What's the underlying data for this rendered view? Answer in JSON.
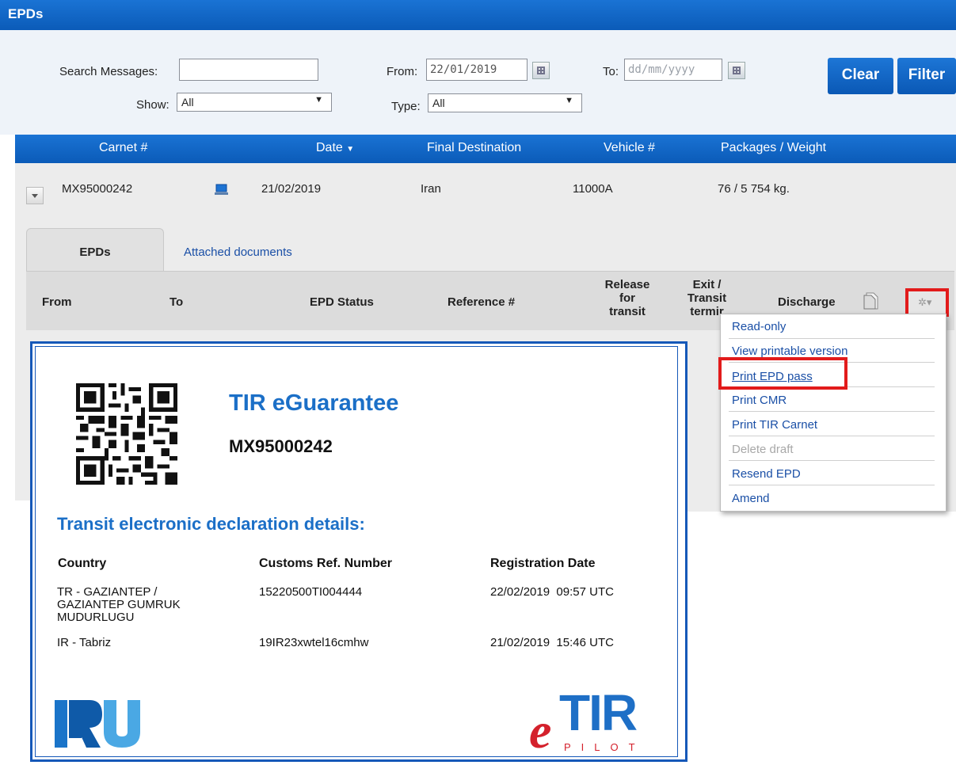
{
  "window": {
    "title": "EPDs"
  },
  "filters": {
    "search_label": "Search Messages:",
    "search_value": "",
    "from_label": "From:",
    "from_value": "22/01/2019",
    "to_label": "To:",
    "to_placeholder": "dd/mm/yyyy",
    "show_label": "Show:",
    "show_value": "All",
    "type_label": "Type:",
    "type_value": "All",
    "clear_label": "Clear",
    "filter_label": "Filter"
  },
  "table": {
    "headers": {
      "carnet": "Carnet #",
      "date": "Date",
      "destination": "Final Destination",
      "vehicle": "Vehicle #",
      "packages": "Packages / Weight"
    },
    "row": {
      "carnet": "MX95000242",
      "date": "21/02/2019",
      "destination": "Iran",
      "vehicle": "11000A",
      "packages": "76 / 5 754 kg."
    }
  },
  "tabs": {
    "epds": "EPDs",
    "attached": "Attached documents"
  },
  "epd_headers": {
    "from": "From",
    "to": "To",
    "status": "EPD Status",
    "reference": "Reference #",
    "release_1": "Release",
    "release_2": "for",
    "release_3": "transit",
    "exit_1": "Exit /",
    "exit_2": "Transit",
    "exit_3": "termir",
    "discharge": "Discharge"
  },
  "menu": {
    "items": [
      {
        "label": "Read-only",
        "enabled": true
      },
      {
        "label": "View printable version",
        "enabled": true
      },
      {
        "label": "Print EPD pass",
        "enabled": true
      },
      {
        "label": "Print CMR",
        "enabled": true
      },
      {
        "label": "Print TIR Carnet",
        "enabled": true
      },
      {
        "label": "Delete draft",
        "enabled": false
      },
      {
        "label": "Resend EPD",
        "enabled": true
      },
      {
        "label": "Amend",
        "enabled": true
      }
    ]
  },
  "pass": {
    "title": "TIR eGuarantee",
    "carnet": "MX95000242",
    "section_title": "Transit electronic declaration details:",
    "col_country": "Country",
    "col_ref": "Customs Ref. Number",
    "col_date": "Registration Date",
    "rows": [
      {
        "country": "TR - GAZIANTEP / GAZIANTEP GUMRUK MUDURLUGU",
        "ref": "15220500TI004444",
        "date": "22/02/2019  09:57 UTC"
      },
      {
        "country": "IR - Tabriz",
        "ref": "19IR23xwtel16cmhw",
        "date": "21/02/2019  15:46 UTC"
      }
    ],
    "etir_word": "TIR",
    "etir_sub": "PILOT"
  },
  "colors": {
    "brand_blue": "#0b5bb8",
    "link_blue": "#1a4fa6",
    "highlight_red": "#e21b1b"
  }
}
